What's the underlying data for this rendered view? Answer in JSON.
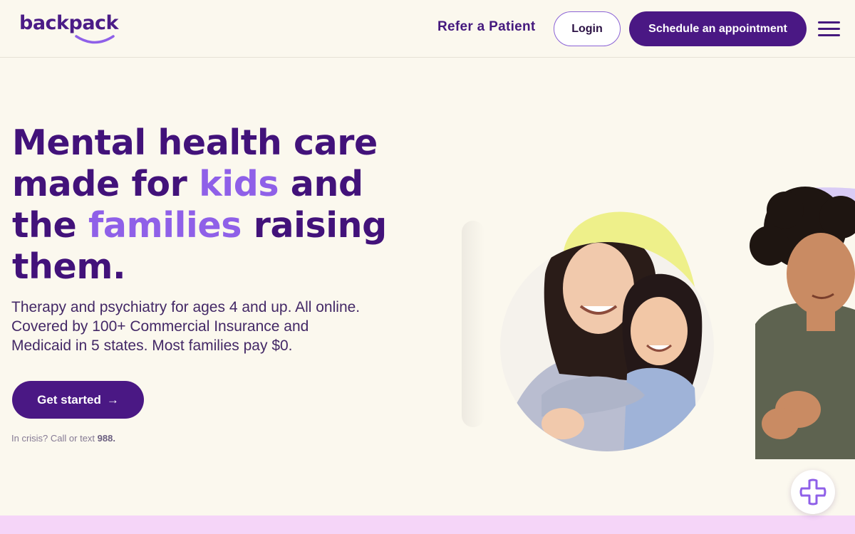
{
  "header": {
    "logo_text": "backpack",
    "refer_label": "Refer a Patient",
    "login_label": "Login",
    "schedule_label": "Schedule an appointment"
  },
  "hero": {
    "headline": {
      "part1": "Mental health care made for ",
      "highlight1": "kids",
      "part2": " and the ",
      "highlight2": "families",
      "part3": " raising them."
    },
    "subtext": "Therapy and psychiatry for ages 4 and up. All online. Covered by 100+ Commercial Insurance and Medicaid in 5 states. Most families pay $0.",
    "cta_label": "Get started",
    "cta_arrow": "→",
    "crisis_prefix": "In crisis? Call or text ",
    "crisis_number": "988."
  },
  "icons": {
    "menu": "hamburger-menu-icon",
    "help": "plus-help-icon",
    "arrow": "arrow-right-icon"
  },
  "colors": {
    "background": "#fbf8ee",
    "brand_purple": "#4a1884",
    "highlight_purple": "#8f60e8",
    "accent_yellow": "#eef08a",
    "band_pink": "#f5d5f8"
  }
}
